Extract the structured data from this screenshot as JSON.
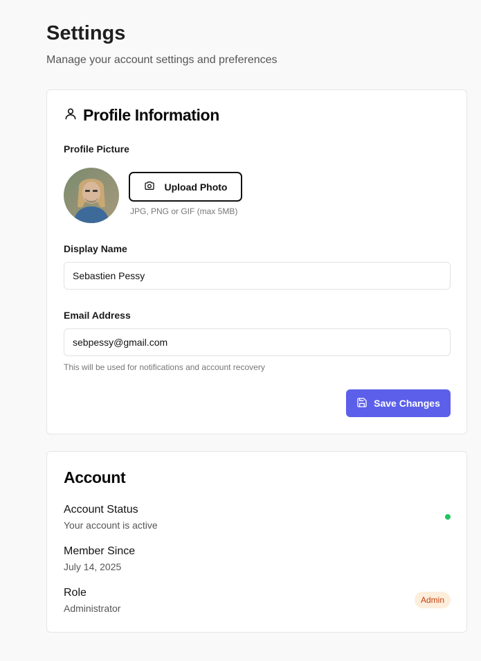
{
  "header": {
    "title": "Settings",
    "subtitle": "Manage your account settings and preferences"
  },
  "profile": {
    "title": "Profile Information",
    "icon": "user-icon",
    "picture_label": "Profile Picture",
    "upload_label": "Upload Photo",
    "upload_icon": "camera-icon",
    "upload_hint": "JPG, PNG or GIF (max 5MB)",
    "display_name_label": "Display Name",
    "display_name_value": "Sebastien Pessy",
    "email_label": "Email Address",
    "email_value": "sebpessy@gmail.com",
    "email_hint": "This will be used for notifications and account recovery",
    "save_label": "Save Changes",
    "save_icon": "save-icon"
  },
  "account": {
    "title": "Account",
    "status_title": "Account Status",
    "status_sub": "Your account is active",
    "member_title": "Member Since",
    "member_sub": "July 14, 2025",
    "role_title": "Role",
    "role_sub": "Administrator",
    "role_badge": "Admin"
  },
  "colors": {
    "accent": "#5b5fe9",
    "status_active": "#22c55e",
    "badge_bg": "#fdeedc",
    "badge_text": "#c2410c"
  }
}
